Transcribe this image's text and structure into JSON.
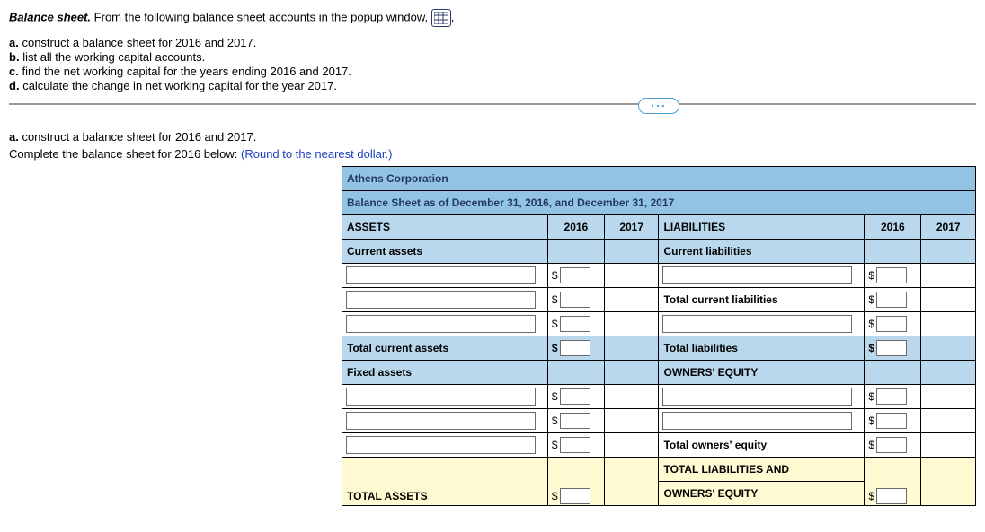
{
  "intro": {
    "title": "Balance sheet.",
    "text": " From the following balance sheet accounts in the popup window, ",
    "comma": ","
  },
  "list": {
    "a": "a. construct a balance sheet for 2016 and 2017.",
    "b": "b. list all the working capital accounts.",
    "c": "c. find the net working capital for the years ending 2016 and 2017.",
    "d": "d. calculate the change in net working capital for the year 2017."
  },
  "section_a": "a. construct a balance sheet for 2016 and 2017.",
  "complete_text": "Complete the balance sheet for 2016 below:  ",
  "round_text": "(Round to the nearest dollar.)",
  "corp": "Athens Corporation",
  "sheet_sub": "Balance Sheet as of December 31, 2016, and December 31, 2017",
  "headers": {
    "assets": "ASSETS",
    "y2016": "2016",
    "y2017": "2017",
    "liab": "LIABILITIES"
  },
  "labels": {
    "current_assets": "Current assets",
    "total_current_assets": "Total current assets",
    "fixed_assets": "Fixed assets",
    "total_assets": "TOTAL ASSETS",
    "current_liab": "Current liabilities",
    "total_current_liab": "Total current liabilities",
    "total_liab": "Total liabilities",
    "owners_equity": "OWNERS' EQUITY",
    "total_owners_equity": "Total owners' equity",
    "tl_and": "TOTAL LIABILITIES AND",
    "tl_oe": "OWNERS' EQUITY"
  },
  "dollar": "$",
  "ellipsis": "..."
}
